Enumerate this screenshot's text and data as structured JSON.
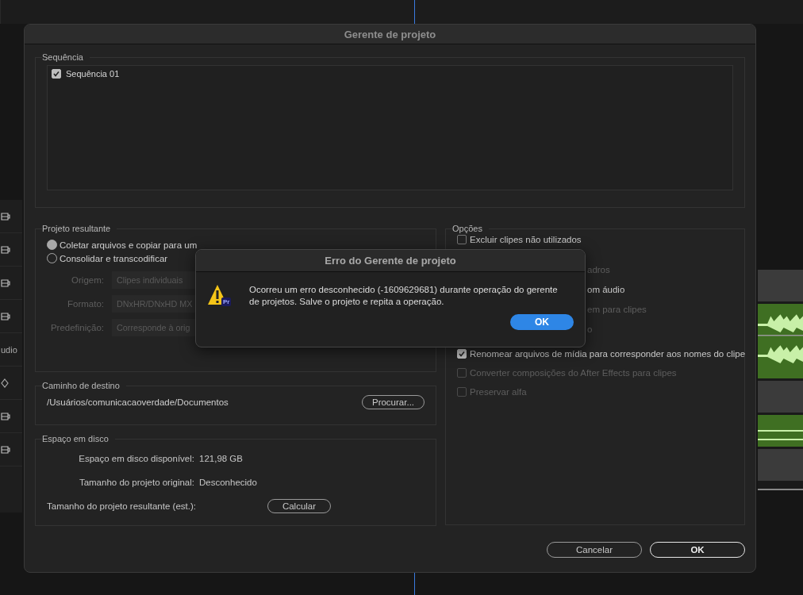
{
  "window": {
    "title": "Gerente de projeto"
  },
  "sequence": {
    "title": "Sequência",
    "items": [
      {
        "label": "Sequência 01",
        "checked": true
      }
    ]
  },
  "resulting_project": {
    "title": "Projeto resultante",
    "choices": [
      {
        "label": "Coletar arquivos e copiar para um",
        "selected": true
      },
      {
        "label": "Consolidar e transcodificar",
        "selected": false
      }
    ],
    "fields": [
      {
        "label": "Origem:",
        "value": "Clipes individuais"
      },
      {
        "label": "Formato:",
        "value": "DNxHR/DNxHD MX"
      },
      {
        "label": "Predefinição:",
        "value": "Corresponde à orig"
      }
    ]
  },
  "destination": {
    "title": "Caminho de destino",
    "path": "/Usuários/comunicacaoverdade/Documentos",
    "browse_button": "Procurar..."
  },
  "disk_space": {
    "title": "Espaço em disco",
    "rows": [
      {
        "label": "Espaço em disco disponível:",
        "value": "121,98 GB"
      },
      {
        "label": "Tamanho do projeto original:",
        "value": "Desconhecido"
      }
    ],
    "estimate_label": "Tamanho do projeto resultante (est.):",
    "calculate_button": "Calcular"
  },
  "options": {
    "title": "Opções",
    "items": [
      {
        "kind": "checkbox",
        "label": "Excluir clipes não utilizados",
        "checked": false,
        "disabled": false
      },
      {
        "kind": "fragment",
        "label": "adros",
        "disabled": true
      },
      {
        "kind": "fragment",
        "label": "om áudio",
        "disabled": false
      },
      {
        "kind": "fragment",
        "label": "em para clipes",
        "disabled": true
      },
      {
        "kind": "fragment",
        "label": "o",
        "disabled": true
      },
      {
        "kind": "checkbox",
        "label": "Renomear arquivos de mídia para corresponder aos nomes do clipe",
        "checked": true,
        "disabled": false
      },
      {
        "kind": "checkbox",
        "label": "Converter composições do After Effects para clipes",
        "checked": false,
        "disabled": true
      },
      {
        "kind": "checkbox",
        "label": "Preservar alfa",
        "checked": false,
        "disabled": true
      }
    ]
  },
  "buttons": [
    {
      "label": "Cancelar",
      "kind": "secondary"
    },
    {
      "label": "OK",
      "kind": "primary"
    }
  ],
  "error_dialog": {
    "title": "Erro do Gerente de projeto",
    "app_badge": "Pr",
    "message": "Ocorreu um erro desconhecido (-1609629681) durante operação do gerente de projetos. Salve o projeto e repita a operação.",
    "button": "OK"
  },
  "background": {
    "track_label": "udio"
  }
}
